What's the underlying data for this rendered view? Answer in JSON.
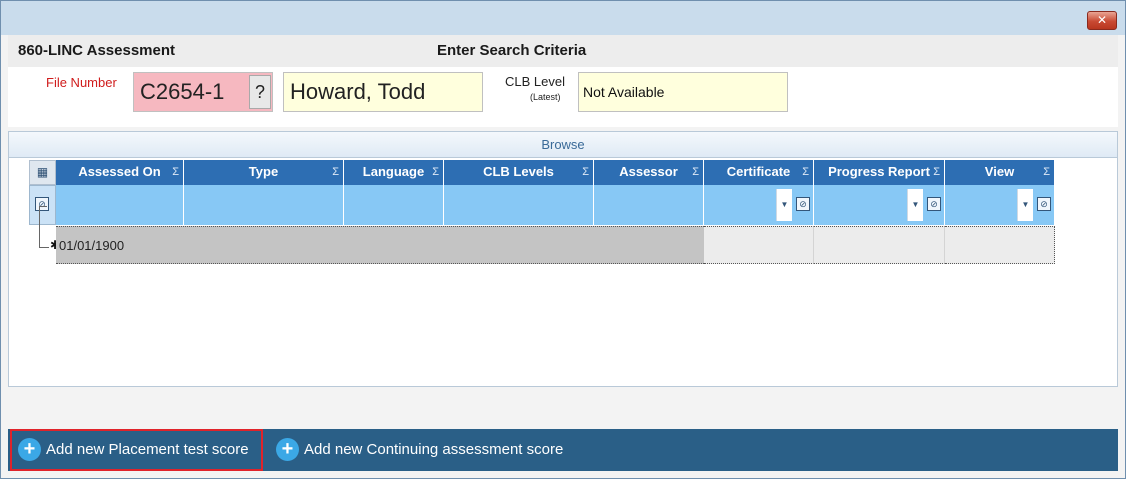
{
  "window": {
    "close_glyph": "✕"
  },
  "header": {
    "app_title": "860-LINC Assessment",
    "search_title": "Enter Search Criteria"
  },
  "criteria": {
    "file_number_label": "File Number",
    "file_number_value": "C2654-1",
    "lookup_button": "?",
    "client_name": "Howard, Todd",
    "clb_level_label": "CLB Level",
    "clb_level_sublabel": "(Latest)",
    "clb_level_value": "Not Available"
  },
  "grid": {
    "panel_title": "Browse",
    "sum_glyph": "Σ",
    "columns": [
      {
        "label": "Assessed On"
      },
      {
        "label": "Type"
      },
      {
        "label": "Language"
      },
      {
        "label": "CLB Levels"
      },
      {
        "label": "Assessor"
      },
      {
        "label": "Certificate"
      },
      {
        "label": "Progress Report"
      },
      {
        "label": "View"
      }
    ],
    "new_row": {
      "assessed_on": "01/01/1900"
    }
  },
  "actions": {
    "add_placement": "Add new Placement test score",
    "add_continuing": "Add new Continuing assessment score"
  },
  "colors": {
    "header_blue": "#2d6eb3",
    "filter_blue": "#87c8f5",
    "action_bar": "#2a5f87",
    "highlight_border": "#e0232a"
  }
}
